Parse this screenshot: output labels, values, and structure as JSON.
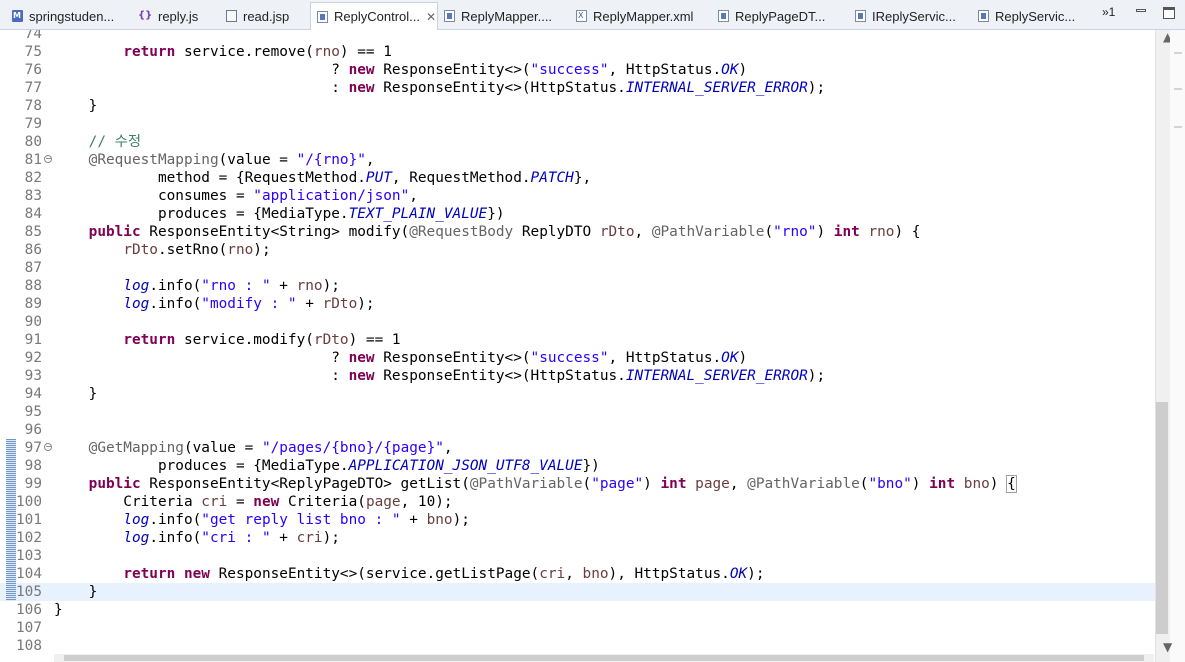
{
  "tabs": [
    {
      "label": "springstuden...",
      "icon": "maven-pom-icon",
      "active": false
    },
    {
      "label": "reply.js",
      "icon": "js-file-icon",
      "active": false
    },
    {
      "label": "read.jsp",
      "icon": "jsp-file-icon",
      "active": false
    },
    {
      "label": "ReplyControl...",
      "icon": "java-file-icon",
      "active": true,
      "close": "✕"
    },
    {
      "label": "ReplyMapper....",
      "icon": "java-file-icon",
      "active": false
    },
    {
      "label": "ReplyMapper.xml",
      "icon": "xml-file-icon",
      "active": false
    },
    {
      "label": "ReplyPageDT...",
      "icon": "java-file-icon",
      "active": false
    },
    {
      "label": "IReplyServic...",
      "icon": "java-file-icon",
      "active": false
    },
    {
      "label": "ReplyServic...",
      "icon": "java-file-icon",
      "active": false
    }
  ],
  "overflow_count": "»1",
  "editor": {
    "line_numbers": [
      "74",
      "75",
      "76",
      "77",
      "78",
      "79",
      "80",
      "81",
      "82",
      "83",
      "84",
      "85",
      "86",
      "87",
      "88",
      "89",
      "90",
      "91",
      "92",
      "93",
      "94",
      "95",
      "96",
      "97",
      "98",
      "99",
      "100",
      "101",
      "102",
      "103",
      "104",
      "105",
      "106",
      "107",
      "108"
    ],
    "lines": [
      "",
      "        return service.remove(rno) == 1",
      "                                ? new ResponseEntity<>(\"success\", HttpStatus.OK)",
      "                                : new ResponseEntity<>(HttpStatus.INTERNAL_SERVER_ERROR);",
      "    }",
      "",
      "    // 수정",
      "    @RequestMapping(value = \"/{rno}\",",
      "            method = {RequestMethod.PUT, RequestMethod.PATCH},",
      "            consumes = \"application/json\",",
      "            produces = {MediaType.TEXT_PLAIN_VALUE})",
      "    public ResponseEntity<String> modify(@RequestBody ReplyDTO rDto, @PathVariable(\"rno\") int rno) {",
      "        rDto.setRno(rno);",
      "",
      "        log.info(\"rno : \" + rno);",
      "        log.info(\"modify : \" + rDto);",
      "",
      "        return service.modify(rDto) == 1",
      "                                ? new ResponseEntity<>(\"success\", HttpStatus.OK)",
      "                                : new ResponseEntity<>(HttpStatus.INTERNAL_SERVER_ERROR);",
      "    }",
      "",
      "",
      "    @GetMapping(value = \"/pages/{bno}/{page}\",",
      "            produces = {MediaType.APPLICATION_JSON_UTF8_VALUE})",
      "    public ResponseEntity<ReplyPageDTO> getList(@PathVariable(\"page\") int page, @PathVariable(\"bno\") int bno) {",
      "        Criteria cri = new Criteria(page, 10);",
      "        log.info(\"get reply list bno : \" + bno);",
      "        log.info(\"cri : \" + cri);",
      "",
      "        return new ResponseEntity<>(service.getListPage(cri, bno), HttpStatus.OK);",
      "    }",
      "}",
      "",
      ""
    ],
    "current_line": "105",
    "cursor": {
      "line": 105,
      "column": 6
    }
  },
  "colors": {
    "keyword": "#7f0055",
    "string": "#2a00ff",
    "annotation": "#646464",
    "comment": "#3f7f5f",
    "field": "#0000c0",
    "current_line_bg": "#e8f2fe"
  }
}
